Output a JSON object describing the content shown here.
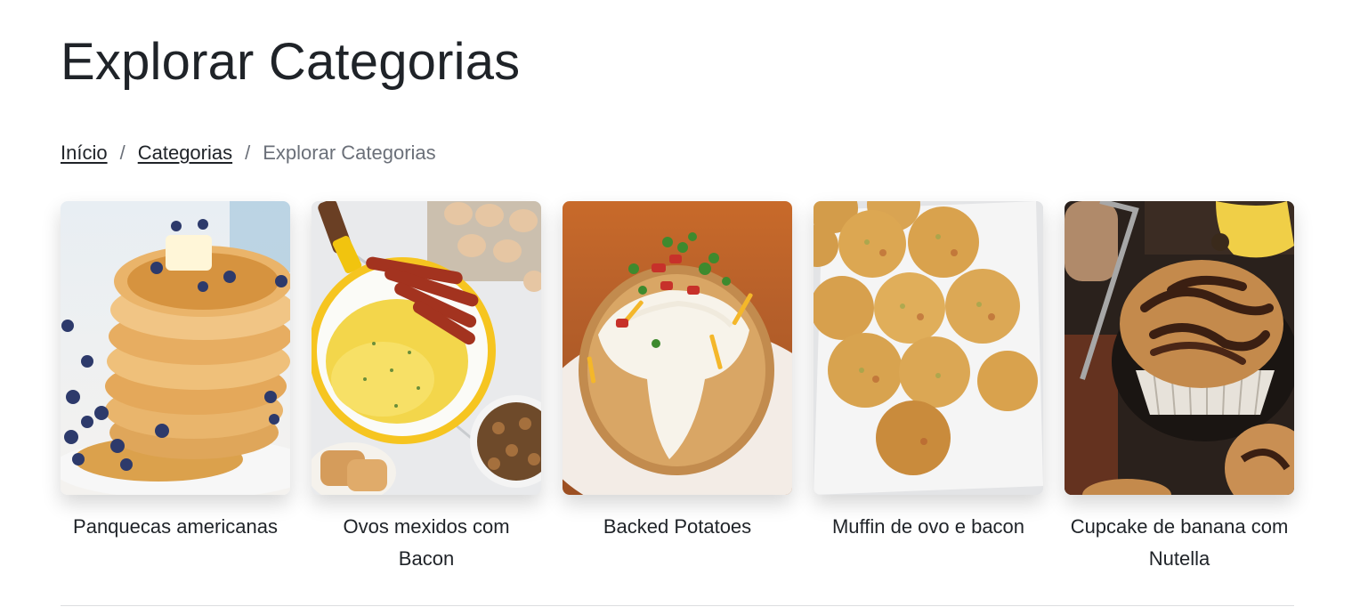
{
  "page": {
    "title": "Explorar Categorias"
  },
  "breadcrumb": {
    "items": [
      {
        "label": "Início",
        "link": true
      },
      {
        "label": "Categorias",
        "link": true
      },
      {
        "label": "Explorar Categorias",
        "link": false
      }
    ],
    "separator": "/"
  },
  "categories": [
    {
      "label": "Panquecas americanas",
      "image": "pancakes-photo"
    },
    {
      "label": "Ovos mexidos com Bacon",
      "image": "scrambled-eggs-bacon-photo"
    },
    {
      "label": "Backed Potatoes",
      "image": "baked-potato-photo"
    },
    {
      "label": "Muffin de ovo e bacon",
      "image": "egg-bacon-muffins-photo"
    },
    {
      "label": "Cupcake de banana com Nutella",
      "image": "banana-nutella-cupcake-photo"
    }
  ],
  "colors": {
    "text": "#1f2328",
    "muted": "#6b7079",
    "divider": "#dcdde0"
  }
}
